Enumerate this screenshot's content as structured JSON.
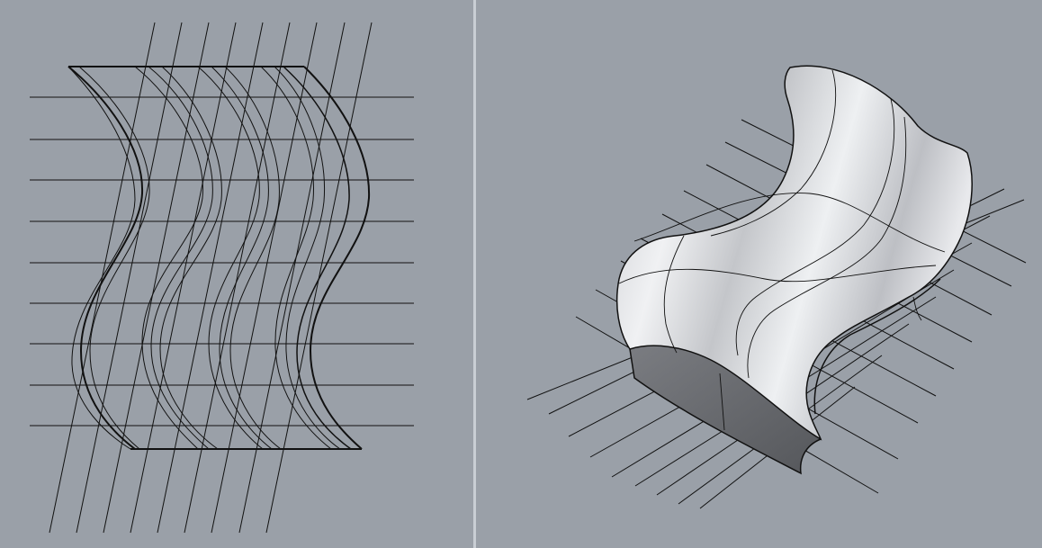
{
  "colors": {
    "viewport_background": "#9aa0a8",
    "divider": "#c9ced4",
    "line": "#111111",
    "surface_light": "#e6e7ea",
    "surface_mid": "#bfc1c6",
    "surface_dark": "#6e7074"
  },
  "viewports": [
    {
      "id": "front-view",
      "content": "wavy-curve-wireframe"
    },
    {
      "id": "perspective-view",
      "content": "shaded-wavy-solid"
    }
  ]
}
